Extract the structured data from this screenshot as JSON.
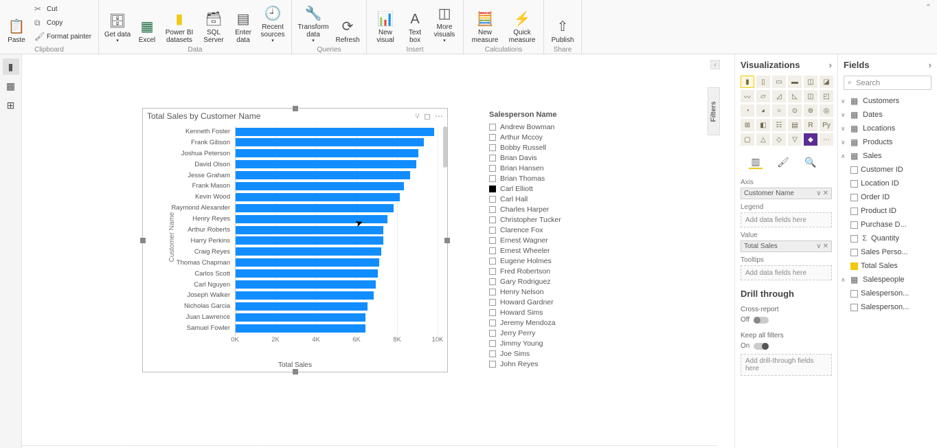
{
  "ribbon": {
    "clipboard": {
      "paste": "Paste",
      "cut": "Cut",
      "copy": "Copy",
      "format": "Format painter",
      "group": "Clipboard"
    },
    "data": {
      "getdata": "Get data",
      "excel": "Excel",
      "pbi": "Power BI datasets",
      "sql": "SQL Server",
      "enter": "Enter data",
      "recent": "Recent sources",
      "group": "Data"
    },
    "queries": {
      "transform": "Transform data",
      "refresh": "Refresh",
      "group": "Queries"
    },
    "insert": {
      "newvis": "New visual",
      "textbox": "Text box",
      "morevis": "More visuals",
      "group": "Insert"
    },
    "calc": {
      "newmeas": "New measure",
      "quickmeas": "Quick measure",
      "group": "Calculations"
    },
    "share": {
      "publish": "Publish",
      "group": "Share"
    }
  },
  "chart_data": {
    "type": "bar",
    "title": "Total Sales by Customer Name",
    "ylabel": "Customer Name",
    "xlabel": "Total Sales",
    "xmax": 10000,
    "xticks": [
      "0K",
      "2K",
      "4K",
      "6K",
      "8K",
      "10K"
    ],
    "categories": [
      "Kenneth Foster",
      "Frank Gibson",
      "Joshua Peterson",
      "David Olson",
      "Jesse Graham",
      "Frank Mason",
      "Kevin Wood",
      "Raymond Alexander",
      "Henry Reyes",
      "Arthur Roberts",
      "Harry Perkins",
      "Craig Reyes",
      "Thomas Chapman",
      "Carlos Scott",
      "Carl Nguyen",
      "Joseph Walker",
      "Nicholas Garcia",
      "Juan Lawrence",
      "Samuel Fowler"
    ],
    "values": [
      9800,
      9300,
      9000,
      8900,
      8600,
      8300,
      8100,
      7800,
      7500,
      7300,
      7300,
      7200,
      7100,
      7000,
      6900,
      6800,
      6500,
      6400,
      6400
    ]
  },
  "slicer": {
    "title": "Salesperson Name",
    "items": [
      "Andrew Bowman",
      "Arthur Mccoy",
      "Bobby Russell",
      "Brian Davis",
      "Brian Hansen",
      "Brian Thomas",
      "Carl Elliott",
      "Carl Hall",
      "Charles Harper",
      "Christopher Tucker",
      "Clarence Fox",
      "Ernest Wagner",
      "Ernest Wheeler",
      "Eugene Holmes",
      "Fred Robertson",
      "Gary Rodriguez",
      "Henry Nelson",
      "Howard Gardner",
      "Howard Sims",
      "Jeremy Mendoza",
      "Jerry Perry",
      "Jimmy Young",
      "Joe Sims",
      "John Reyes"
    ],
    "selected": "Carl Elliott"
  },
  "viz": {
    "header": "Visualizations",
    "axis": "Axis",
    "axis_val": "Customer Name",
    "legend": "Legend",
    "legend_ph": "Add data fields here",
    "value": "Value",
    "value_val": "Total Sales",
    "tooltips": "Tooltips",
    "tooltips_ph": "Add data fields here",
    "drill": "Drill through",
    "cross": "Cross-report",
    "off": "Off",
    "keep": "Keep all filters",
    "on": "On",
    "drill_ph": "Add drill-through fields here"
  },
  "fields": {
    "header": "Fields",
    "search": "Search",
    "tables": {
      "customers": "Customers",
      "dates": "Dates",
      "locations": "Locations",
      "products": "Products",
      "sales": "Sales",
      "salespeople": "Salespeople"
    },
    "sales_cols": [
      "Customer ID",
      "Location ID",
      "Order ID",
      "Product ID",
      "Purchase D...",
      "Quantity",
      "Sales Perso...",
      "Total Sales"
    ],
    "sp_cols": [
      "Salesperson...",
      "Salesperson..."
    ]
  },
  "filters_tab": "Filters"
}
